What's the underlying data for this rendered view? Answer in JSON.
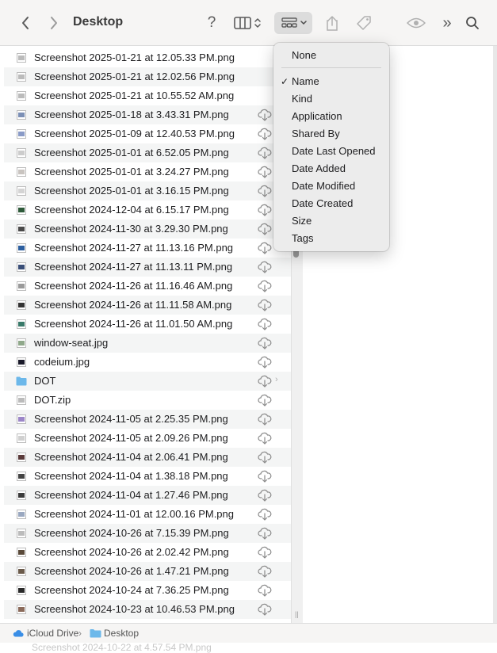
{
  "window": {
    "title": "Desktop"
  },
  "toolbar": {
    "back_icon": "chevron-left",
    "forward_icon": "chevron-right",
    "help_label": "?",
    "view_icon": "columns",
    "group_icon": "grid-group",
    "share_icon": "share",
    "tag_icon": "tag",
    "quicklook_icon": "eye",
    "more_label": "»",
    "search_icon": "magnifier"
  },
  "files": [
    {
      "name": "Screenshot 2025-01-21 at 12.05.33 PM.png",
      "cloud": false,
      "thumb": "#bbbbbb"
    },
    {
      "name": "Screenshot 2025-01-21 at 12.02.56 PM.png",
      "cloud": false,
      "thumb": "#bbbbbb"
    },
    {
      "name": "Screenshot 2025-01-21 at 10.55.52 AM.png",
      "cloud": false,
      "thumb": "#bbbbbb"
    },
    {
      "name": "Screenshot 2025-01-18 at 3.43.31 PM.png",
      "cloud": true,
      "thumb": "#7b8fb5"
    },
    {
      "name": "Screenshot 2025-01-09 at 12.40.53 PM.png",
      "cloud": true,
      "thumb": "#8a9bc7"
    },
    {
      "name": "Screenshot 2025-01-01 at 6.52.05 PM.png",
      "cloud": true,
      "thumb": "#cccccc"
    },
    {
      "name": "Screenshot 2025-01-01 at 3.24.27 PM.png",
      "cloud": true,
      "thumb": "#c9c4c0"
    },
    {
      "name": "Screenshot 2025-01-01 at 3.16.15 PM.png",
      "cloud": true,
      "thumb": "#d4d4d4"
    },
    {
      "name": "Screenshot 2024-12-04 at 6.15.17 PM.png",
      "cloud": true,
      "thumb": "#2e5a3a"
    },
    {
      "name": "Screenshot 2024-11-30 at 3.29.30 PM.png",
      "cloud": true,
      "thumb": "#4a4a4a"
    },
    {
      "name": "Screenshot 2024-11-27 at 11.13.16 PM.png",
      "cloud": true,
      "thumb": "#2d5fa0"
    },
    {
      "name": "Screenshot 2024-11-27 at 11.13.11 PM.png",
      "cloud": true,
      "thumb": "#3a4f78"
    },
    {
      "name": "Screenshot 2024-11-26 at 11.16.46 AM.png",
      "cloud": true,
      "thumb": "#9a9a9a"
    },
    {
      "name": "Screenshot 2024-11-26 at 11.11.58 AM.png",
      "cloud": true,
      "thumb": "#333333"
    },
    {
      "name": "Screenshot 2024-11-26 at 11.01.50 AM.png",
      "cloud": true,
      "thumb": "#3a7a6a"
    },
    {
      "name": "window-seat.jpg",
      "cloud": true,
      "thumb": "#8fa88a"
    },
    {
      "name": "codeium.jpg",
      "cloud": true,
      "thumb": "#1a1a2a"
    },
    {
      "name": "DOT",
      "cloud": true,
      "folder": true,
      "thumb": "#6cb8ea"
    },
    {
      "name": "DOT.zip",
      "cloud": true,
      "thumb": "#bbbbbb"
    },
    {
      "name": "Screenshot 2024-11-05 at 2.25.35 PM.png",
      "cloud": true,
      "thumb": "#9c86c8"
    },
    {
      "name": "Screenshot 2024-11-05 at 2.09.26 PM.png",
      "cloud": true,
      "thumb": "#d0d0d0"
    },
    {
      "name": "Screenshot 2024-11-04 at 2.06.41 PM.png",
      "cloud": true,
      "thumb": "#5a3a3a"
    },
    {
      "name": "Screenshot 2024-11-04 at 1.38.18 PM.png",
      "cloud": true,
      "thumb": "#444444"
    },
    {
      "name": "Screenshot 2024-11-04 at 1.27.46 PM.png",
      "cloud": true,
      "thumb": "#3a3a3a"
    },
    {
      "name": "Screenshot 2024-11-01 at 12.00.16 PM.png",
      "cloud": true,
      "thumb": "#9aa8c0"
    },
    {
      "name": "Screenshot 2024-10-26 at 7.15.39 PM.png",
      "cloud": true,
      "thumb": "#bbbbbb"
    },
    {
      "name": "Screenshot 2024-10-26 at 2.02.42 PM.png",
      "cloud": true,
      "thumb": "#5a4a3a"
    },
    {
      "name": "Screenshot 2024-10-26 at 1.47.21 PM.png",
      "cloud": true,
      "thumb": "#6a5a4a"
    },
    {
      "name": "Screenshot 2024-10-24 at 7.36.25 PM.png",
      "cloud": true,
      "thumb": "#2a2a2a"
    },
    {
      "name": "Screenshot 2024-10-23 at 10.46.53 PM.png",
      "cloud": true,
      "thumb": "#8a6a5a"
    }
  ],
  "ghost_row": "Screenshot 2024-10-22 at 4.57.54 PM.png",
  "group_menu": {
    "items": [
      "None",
      "Name",
      "Kind",
      "Application",
      "Shared By",
      "Date Last Opened",
      "Date Added",
      "Date Modified",
      "Date Created",
      "Size",
      "Tags"
    ],
    "checked": "Name",
    "checkmark": "✓"
  },
  "pathbar": {
    "items": [
      "iCloud Drive",
      "Desktop"
    ],
    "separator": "›"
  },
  "colors": {
    "folder": "#6cb8ea",
    "icloud": "#3a8ee6",
    "menu_bg": "#ececec",
    "toolbar_bg": "#f6f5f4"
  }
}
